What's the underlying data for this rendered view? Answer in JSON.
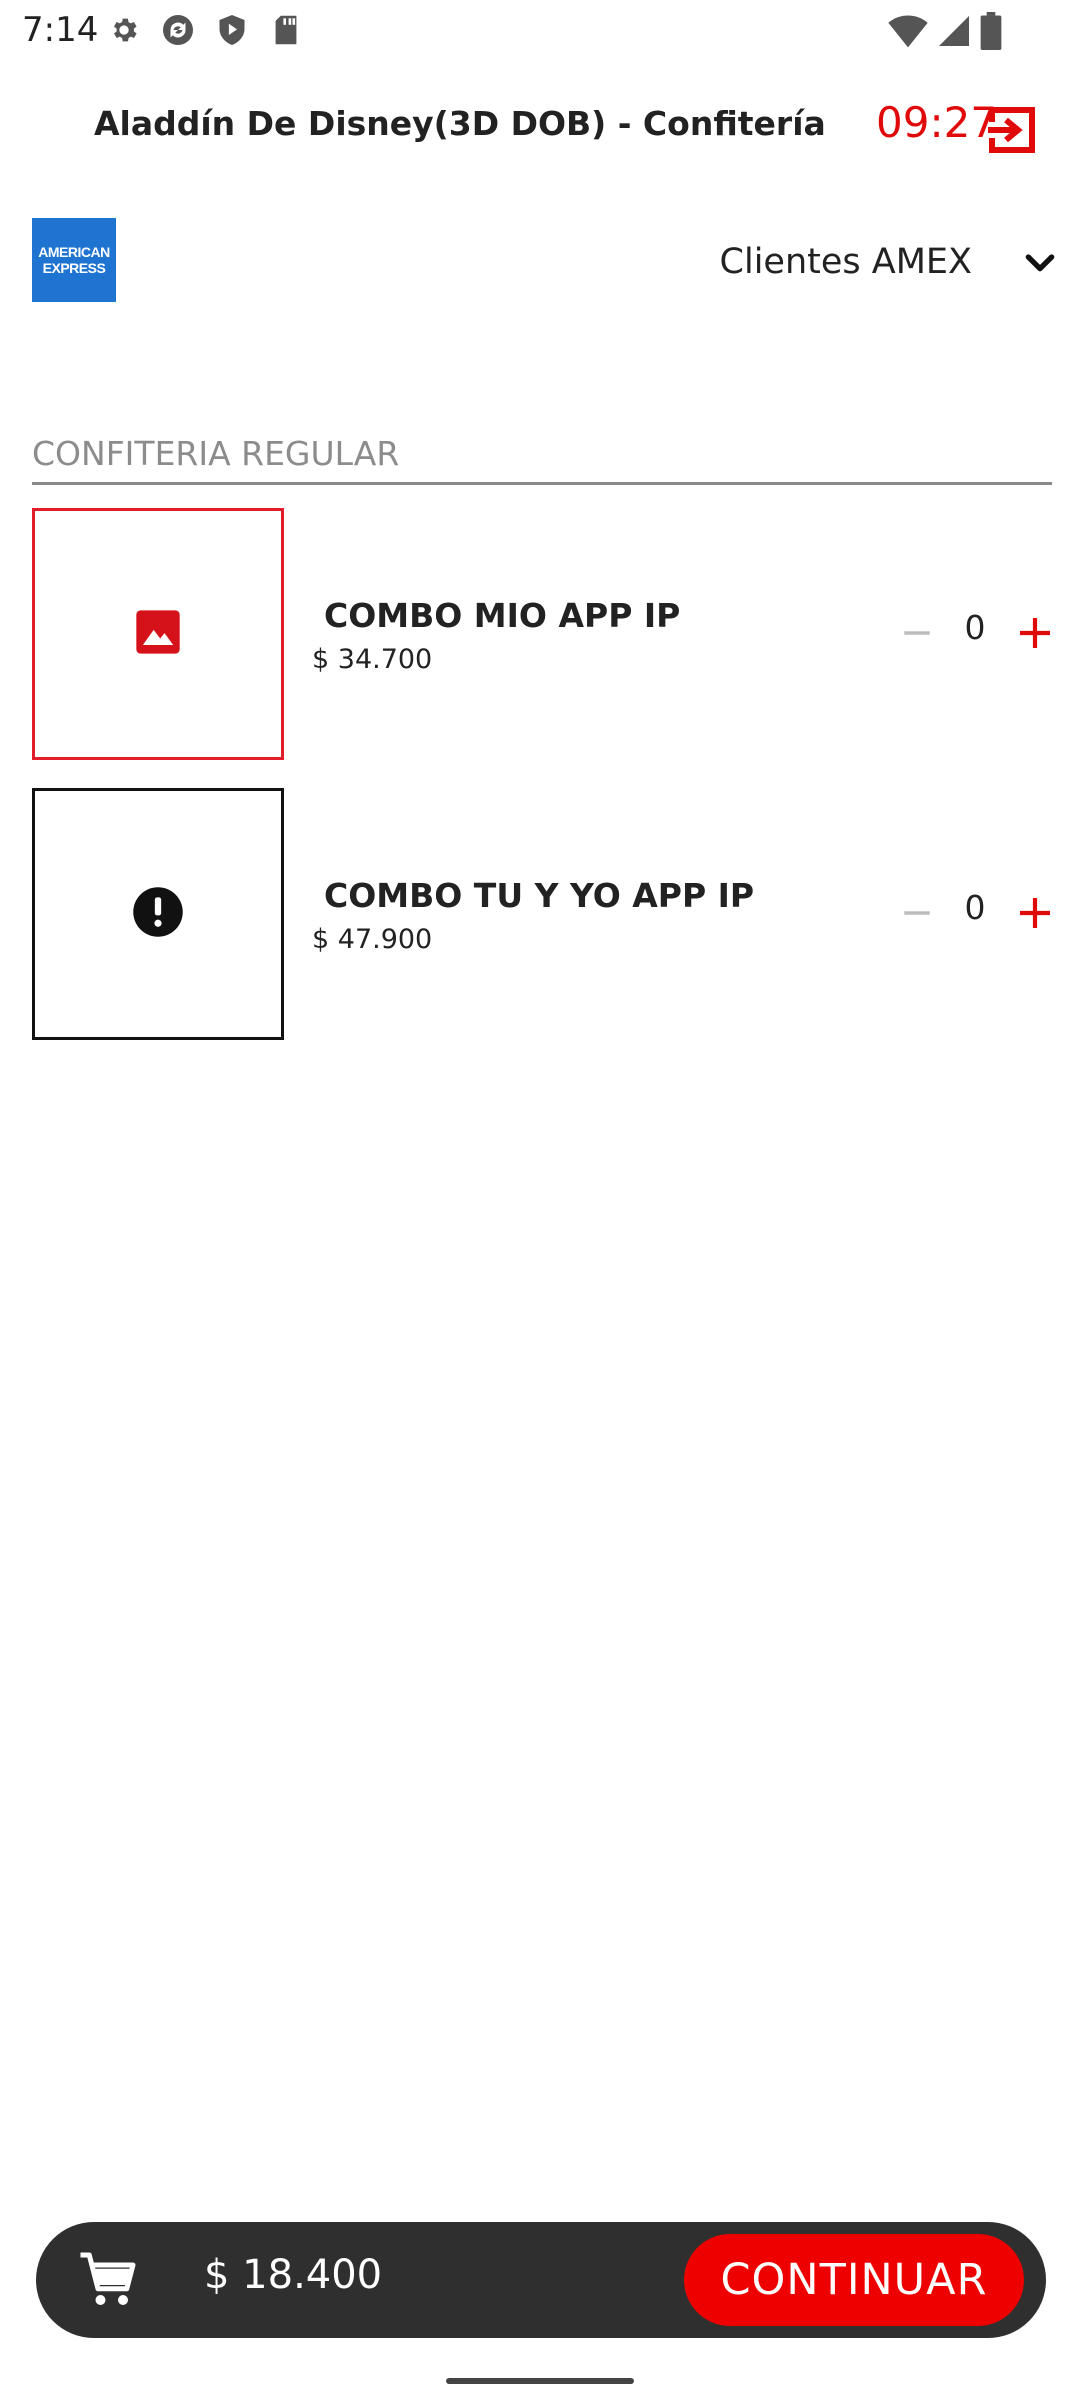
{
  "status_bar": {
    "time": "7:14",
    "left_icons": [
      "gear-icon",
      "sync-icon",
      "shield-play-icon",
      "sd-card-icon"
    ],
    "right_icons": [
      "wifi-icon",
      "cell-signal-icon",
      "battery-icon"
    ]
  },
  "header": {
    "title": "Aladdín De Disney(3D DOB) - Confitería",
    "timer": "09:27",
    "exit_icon": "exit-icon"
  },
  "card_selector": {
    "logo_line1": "AMERICAN",
    "logo_line2": "EXPRESS",
    "label": "Clientes AMEX"
  },
  "section": {
    "title": "CONFITERIA REGULAR"
  },
  "products": [
    {
      "name": "COMBO MIO APP IP",
      "price": "$ 34.700",
      "quantity": "0",
      "thumb_icon": "image-icon"
    },
    {
      "name": "COMBO TU Y YO APP IP",
      "price": "$ 47.900",
      "quantity": "0",
      "thumb_icon": "error-icon"
    }
  ],
  "footer": {
    "total": "$ 18.400",
    "continue_label": "CONTINUAR"
  },
  "colors": {
    "accent": "#e10a0a",
    "bar": "#2f2f2f",
    "amex": "#1f74d1"
  }
}
